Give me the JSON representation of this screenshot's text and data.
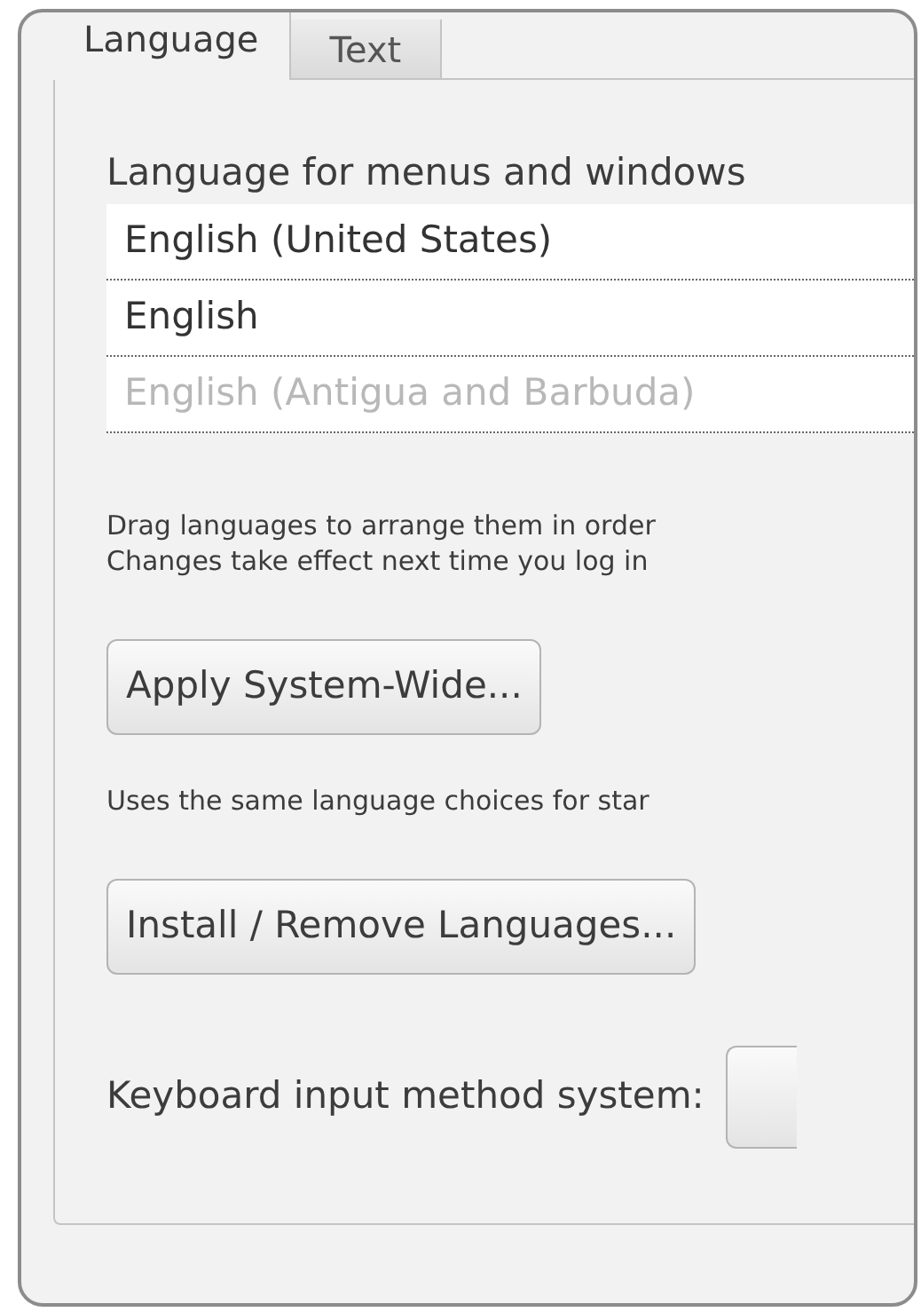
{
  "tabs": [
    {
      "label": "Language",
      "selected": true
    },
    {
      "label": "Text",
      "selected": false
    }
  ],
  "language_section": {
    "heading": "Language for menus and windows",
    "languages": [
      {
        "name": "English (United States)",
        "disabled": false
      },
      {
        "name": "English",
        "disabled": false
      },
      {
        "name": "English (Antigua and Barbuda)",
        "disabled": true
      }
    ],
    "hint_lines": [
      "Drag languages to arrange them in order",
      "Changes take effect next time you log in"
    ],
    "apply_button": "Apply System-Wide...",
    "apply_note": "Uses the same language choices for star",
    "install_button": "Install / Remove Languages...",
    "keyboard_label": "Keyboard input method system:"
  }
}
